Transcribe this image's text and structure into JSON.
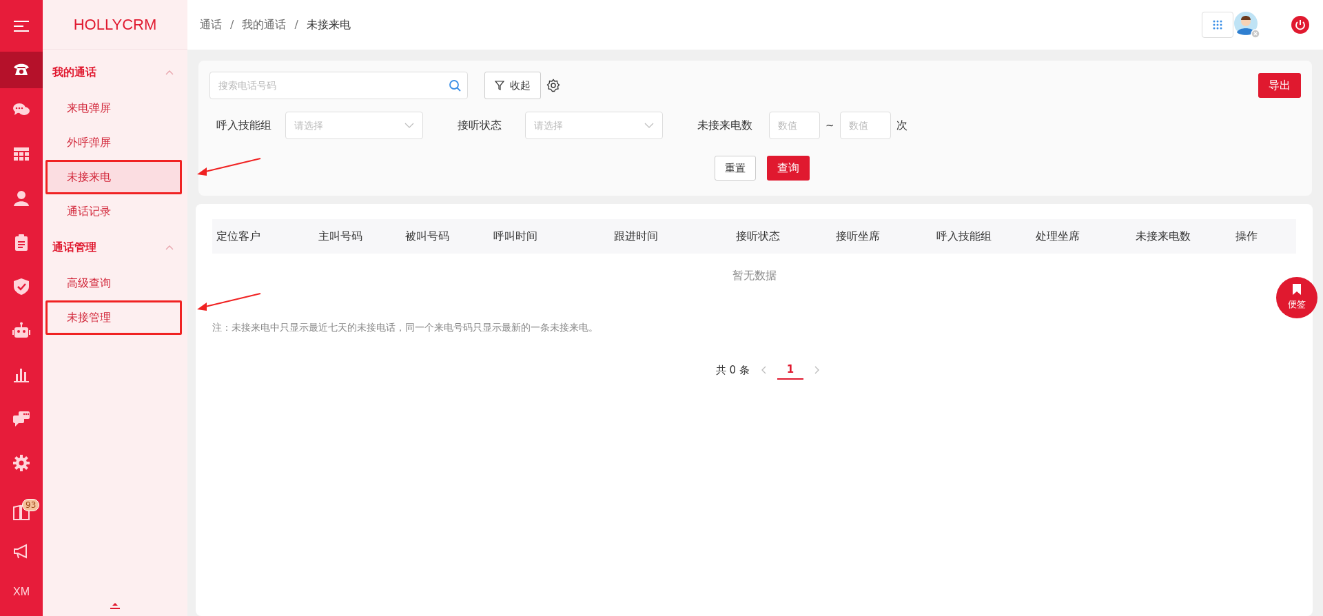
{
  "rail": {
    "items": [
      {
        "selected": true
      },
      {
        "selected": false
      },
      {
        "selected": false
      },
      {
        "selected": false
      },
      {
        "selected": false
      },
      {
        "selected": false
      },
      {
        "selected": false
      },
      {
        "selected": false
      },
      {
        "selected": false
      },
      {
        "selected": false
      }
    ],
    "bottom": [
      {
        "kind": "book",
        "badge": "93"
      },
      {
        "kind": "megaphone"
      },
      {
        "kind": "initials",
        "text": "XM"
      }
    ]
  },
  "sidebar": {
    "brand": "HOLLYCRM",
    "groups": [
      {
        "title": "我的通话",
        "expanded": true,
        "items": [
          {
            "label": "来电弹屏",
            "selected": false,
            "annotated": false
          },
          {
            "label": "外呼弹屏",
            "selected": false,
            "annotated": false
          },
          {
            "label": "未接来电",
            "selected": true,
            "annotated": true
          },
          {
            "label": "通话记录",
            "selected": false,
            "annotated": false
          }
        ]
      },
      {
        "title": "通话管理",
        "expanded": true,
        "items": [
          {
            "label": "高级查询",
            "selected": false,
            "annotated": false
          },
          {
            "label": "未接管理",
            "selected": false,
            "annotated": true
          }
        ]
      }
    ]
  },
  "breadcrumb": {
    "items": [
      "通话",
      "我的通话",
      "未接来电"
    ],
    "separators": [
      "/",
      "/"
    ]
  },
  "filter": {
    "search": {
      "placeholder": "搜索电话号码"
    },
    "collapse_button": "收起",
    "export_button": "导出",
    "fields": [
      {
        "label": "呼入技能组",
        "placeholder": "请选择"
      },
      {
        "label": "接听状态",
        "placeholder": "请选择"
      }
    ],
    "range": {
      "label": "未接来电数",
      "min_placeholder": "数值",
      "separator": "~",
      "max_placeholder": "数值",
      "unit": "次"
    },
    "reset_button": "重置",
    "query_button": "查询"
  },
  "table": {
    "columns": [
      "定位客户",
      "主叫号码",
      "被叫号码",
      "呼叫时间",
      "跟进时间",
      "接听状态",
      "接听坐席",
      "呼入技能组",
      "处理坐席",
      "未接来电数",
      "操作"
    ],
    "empty_text": "暂无数据"
  },
  "note": "注：未接来电中只显示最近七天的未接电话，同一个来电号码只显示最新的一条未接来电。",
  "pagination": {
    "total": "共 0 条",
    "pages": [
      {
        "label": "1",
        "selected": true
      }
    ]
  },
  "float_button": "便签"
}
